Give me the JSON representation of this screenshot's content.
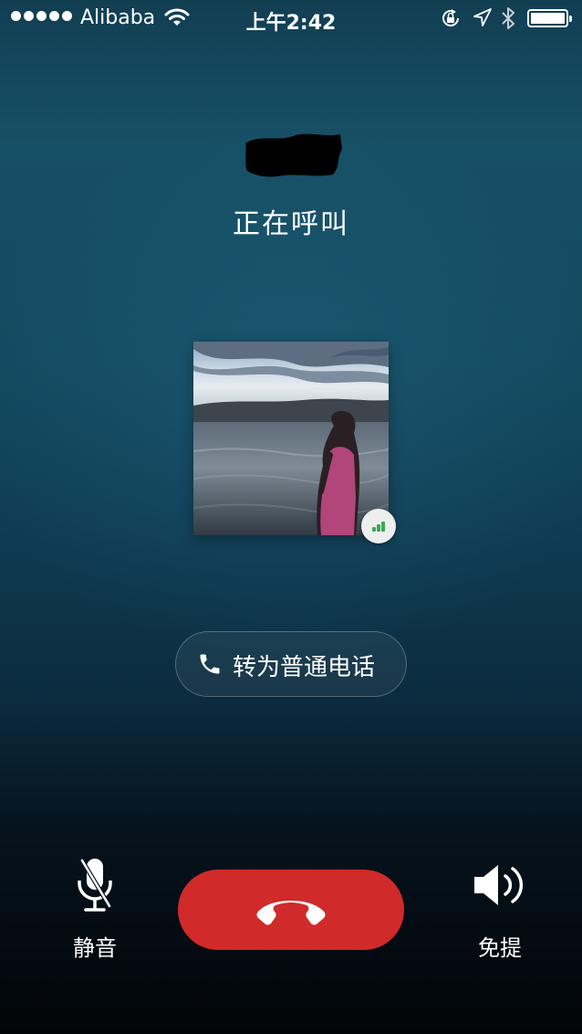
{
  "status_bar": {
    "signal_dots": 5,
    "carrier": "Alibaba",
    "time": "上午2:42",
    "icons": [
      "wifi-icon",
      "rotation-lock-icon",
      "location-arrow-icon",
      "bluetooth-icon",
      "battery-icon"
    ],
    "battery_level": 1.0
  },
  "call": {
    "status": "正在呼叫",
    "signal_quality": 0.75
  },
  "switch_call": {
    "label": "转为普通电话"
  },
  "actions": {
    "mute_label": "静音",
    "speaker_label": "免提"
  },
  "colors": {
    "hangup": "#d02a2a",
    "signal": "#3aaa56"
  }
}
